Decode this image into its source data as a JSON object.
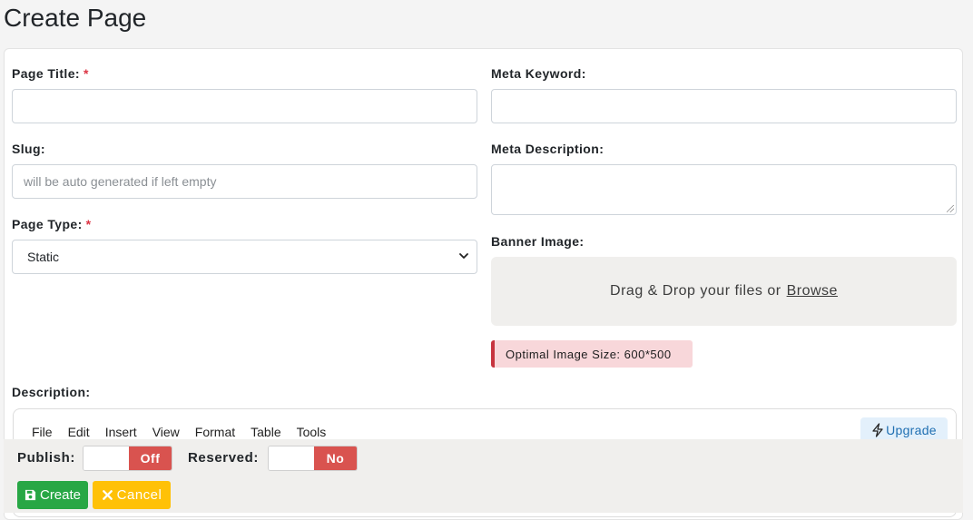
{
  "page": {
    "title": "Create Page"
  },
  "form": {
    "page_title": {
      "label": "Page Title:",
      "required_mark": "*",
      "value": ""
    },
    "slug": {
      "label": "Slug:",
      "placeholder": "will be auto generated if left empty",
      "value": ""
    },
    "page_type": {
      "label": "Page Type:",
      "required_mark": "*",
      "selected": "Static"
    },
    "meta_keyword": {
      "label": "Meta Keyword:",
      "value": ""
    },
    "meta_description": {
      "label": "Meta Description:",
      "value": ""
    },
    "banner_image": {
      "label": "Banner Image:",
      "dropzone_text": "Drag & Drop your files or",
      "browse_link": "Browse",
      "hint": "Optimal Image Size: 600*500"
    },
    "description": {
      "label": "Description:",
      "menu": [
        "File",
        "Edit",
        "Insert",
        "View",
        "Format",
        "Table",
        "Tools"
      ],
      "upgrade_label": "Upgrade"
    }
  },
  "footer": {
    "publish": {
      "label": "Publish:",
      "state": "Off"
    },
    "reserved": {
      "label": "Reserved:",
      "state": "No"
    },
    "create_label": "Create",
    "cancel_label": "Cancel"
  },
  "colors": {
    "required": "#dc3545",
    "toggle_off": "#d9534f",
    "create": "#28a745",
    "cancel": "#ffc107",
    "alert_bg": "#f8d7da",
    "alert_border": "#c7343f",
    "upgrade_text": "#1f6fb2"
  },
  "icons": {
    "select_arrow": "chevron-down-icon",
    "upgrade": "lightning-icon",
    "create": "save-icon",
    "cancel": "close-icon"
  }
}
